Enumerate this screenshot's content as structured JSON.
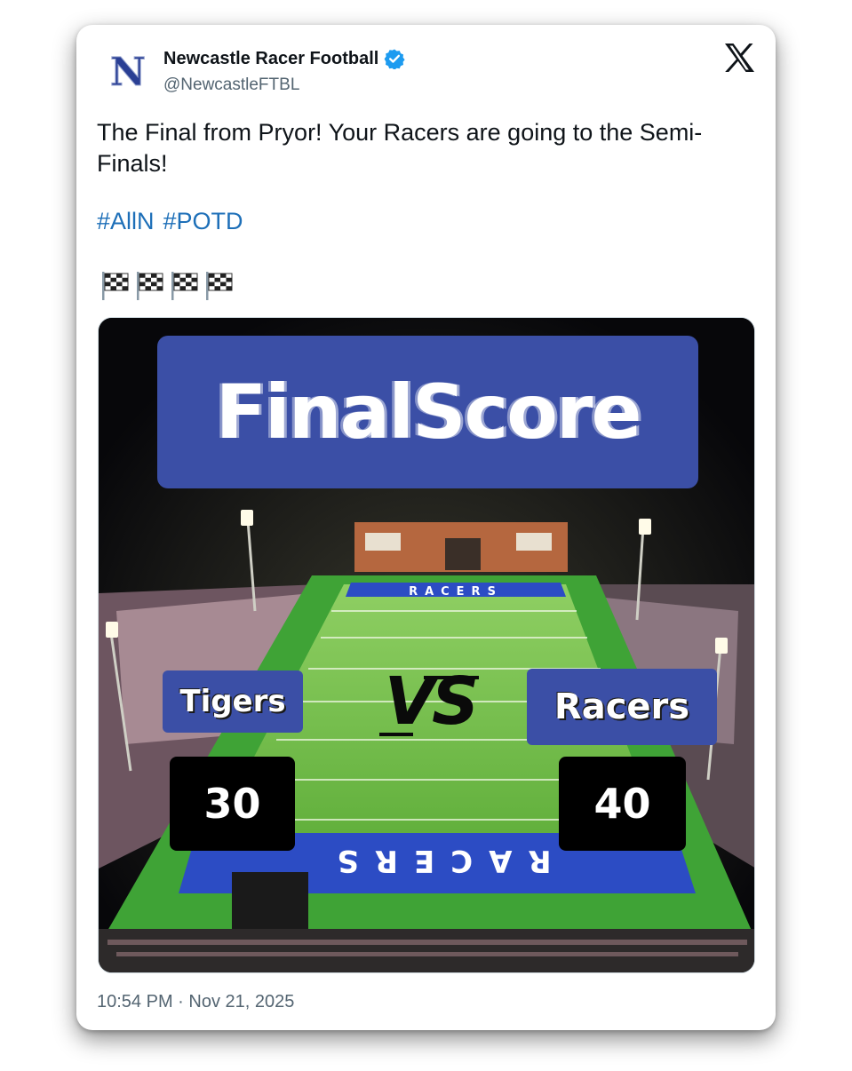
{
  "author": {
    "display_name": "Newcastle Racer Football",
    "handle": "@NewcastleFTBL",
    "avatar_letter": "N",
    "verified_icon": "verified-badge-icon",
    "brand_color": "#2a3f94"
  },
  "platform": {
    "logo": "x-logo-icon"
  },
  "post": {
    "text": "The Final from Pryor! Your Racers are going to the Semi-Finals!",
    "hashtags": [
      "#AllN",
      "#POTD"
    ],
    "emoji_flags": [
      "🏁",
      "🏁",
      "🏁",
      "🏁"
    ]
  },
  "media": {
    "banner": "FinalScore",
    "vs": "VS",
    "field_text_top": "RACERS",
    "field_text_bottom": "RACERS",
    "team_left": {
      "name": "Tigers",
      "score": "30"
    },
    "team_right": {
      "name": "Racers",
      "score": "40"
    },
    "accent_color": "#3b4fa6"
  },
  "timestamp": "10:54 PM · Nov 21, 2025",
  "link_color": "#1d6fb8"
}
